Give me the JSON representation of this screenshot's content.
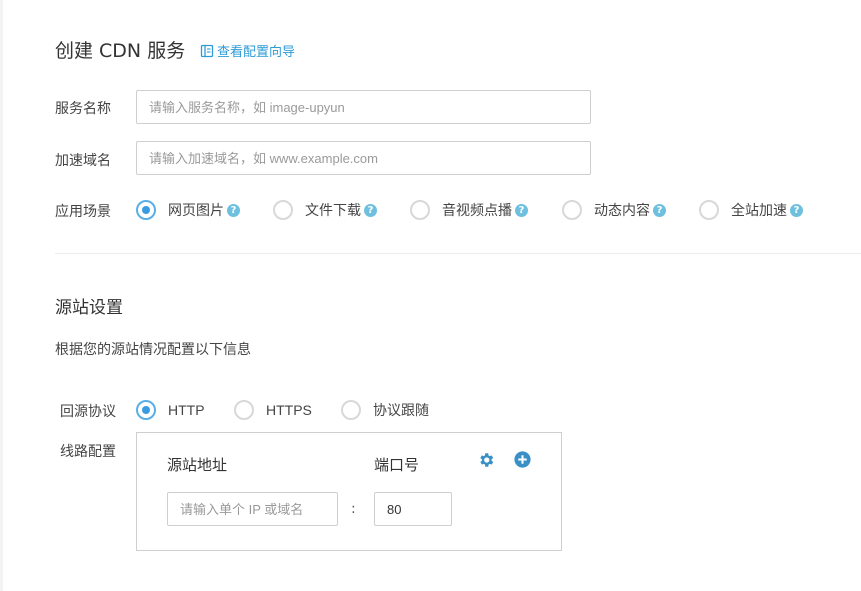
{
  "header": {
    "title": "创建 CDN 服务",
    "guide_link": "查看配置向导"
  },
  "form": {
    "service_name": {
      "label": "服务名称",
      "placeholder": "请输入服务名称，如 image-upyun"
    },
    "domain": {
      "label": "加速域名",
      "placeholder": "请输入加速域名，如 www.example.com"
    },
    "scenario": {
      "label": "应用场景",
      "options": [
        "网页图片",
        "文件下载",
        "音视频点播",
        "动态内容",
        "全站加速"
      ],
      "selected": "网页图片"
    }
  },
  "origin": {
    "title": "源站设置",
    "description": "根据您的源站情况配置以下信息",
    "protocol": {
      "label": "回源协议",
      "options": [
        "HTTP",
        "HTTPS",
        "协议跟随"
      ],
      "selected": "HTTP"
    },
    "route": {
      "label": "线路配置",
      "address_header": "源站地址",
      "port_header": "端口号",
      "address_placeholder": "请输入单个 IP 或域名",
      "separator": ":",
      "port_value": "80"
    }
  },
  "icons": {
    "guide": "guide-doc-icon",
    "help": "help-icon",
    "settings": "gear-icon",
    "add": "plus-circle-icon"
  },
  "colors": {
    "accent": "#2e9bd6",
    "help_icon": "#6fc0de",
    "radio_checked": "#3a9be0"
  }
}
